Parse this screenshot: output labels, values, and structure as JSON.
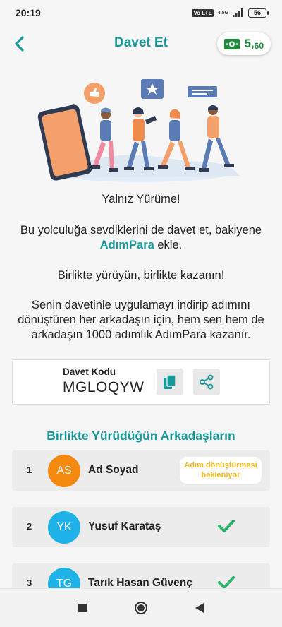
{
  "status": {
    "time": "20:19",
    "volte": "Vo LTE",
    "network": "4,5G",
    "battery": "56"
  },
  "header": {
    "title": "Davet Et",
    "wallet_value": "5,",
    "wallet_decimals": "60",
    "wallet_color": "#1f8a3c",
    "accent": "#17989a"
  },
  "intro": {
    "heading": "Yalnız Yürüme!",
    "invite_pre": "Bu yolculuğa sevdiklerini de davet et, bakiyene",
    "brand": "AdımPara",
    "invite_post": " ekle.",
    "together": "Birlikte yürüyün, birlikte kazanın!",
    "reward": "Senin davetinle uygulamayı indirip adımını dönüştüren her arkadaşın için, hem sen hem de arkadaşın 1000 adımlık AdımPara kazanır."
  },
  "invite_code": {
    "label": "Davet Kodu",
    "value": "MGLOQYW",
    "copy_icon": "copy-icon",
    "share_icon": "share-icon"
  },
  "friends": {
    "title": "Birlikte Yürüdüğün Arkadaşların",
    "items": [
      {
        "rank": "1",
        "initials": "AS",
        "name": "Ad Soyad",
        "status": "Adım dönüştürmesi bekleniyor",
        "avatar_color": "#f5890f"
      },
      {
        "rank": "2",
        "initials": "YK",
        "name": "Yusuf Karataş",
        "status": "check",
        "avatar_color": "#1fb2e8"
      },
      {
        "rank": "3",
        "initials": "TG",
        "name": "Tarık Hasan Güvenç",
        "status": "check",
        "avatar_color": "#1fb2e8"
      }
    ]
  },
  "nav": {
    "recent_icon": "square-icon",
    "home_icon": "circle-icon",
    "back_icon": "triangle-back-icon"
  }
}
